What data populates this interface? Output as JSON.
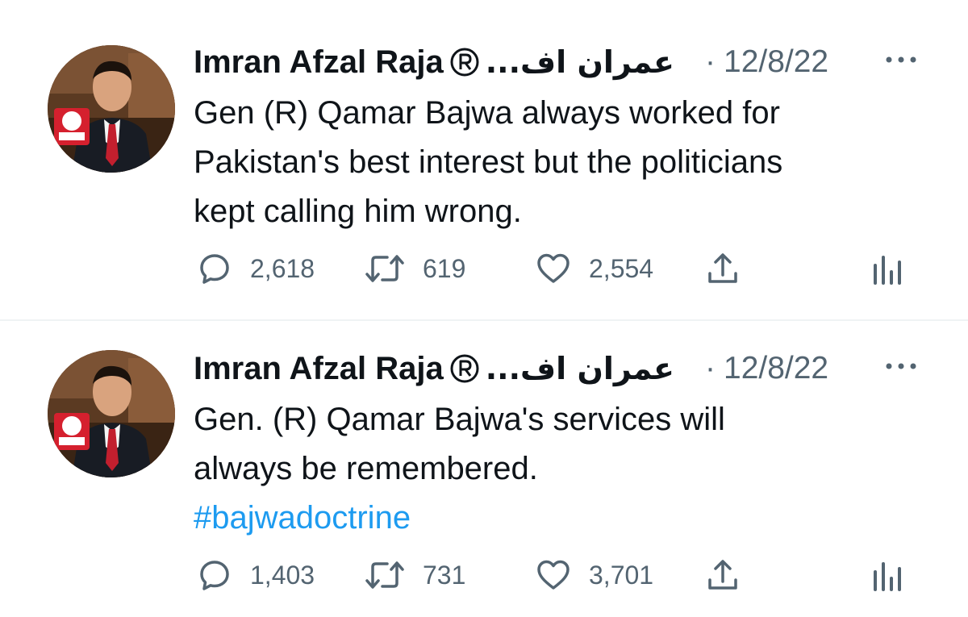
{
  "tweets": [
    {
      "author": {
        "name": "Imran Afzal Raja",
        "badge": "®",
        "urdu_name": "عمران اف...",
        "avatar": "profile-photo"
      },
      "date": "12/8/22",
      "separator": "·",
      "text_lines": [
        "Gen (R) Qamar Bajwa always worked for",
        "Pakistan's best interest but the politicians",
        "kept calling him wrong."
      ],
      "hashtag": "",
      "stats": {
        "replies": "2,618",
        "retweets": "619",
        "likes": "2,554"
      }
    },
    {
      "author": {
        "name": "Imran Afzal Raja",
        "badge": "®",
        "urdu_name": "عمران اف...",
        "avatar": "profile-photo"
      },
      "date": "12/8/22",
      "separator": "·",
      "text_lines": [
        "Gen. (R) Qamar Bajwa's services will",
        "always be remembered."
      ],
      "hashtag": "#bajwadoctrine",
      "stats": {
        "replies": "1,403",
        "retweets": "731",
        "likes": "3,701"
      }
    }
  ],
  "icons": {
    "reply": "reply-icon",
    "retweet": "retweet-icon",
    "like": "heart-icon",
    "share": "share-icon",
    "analytics": "analytics-icon",
    "more": "more-icon"
  },
  "colors": {
    "text": "#0f1419",
    "muted": "#536471",
    "link": "#1d9bf0",
    "divider": "#eff3f4"
  }
}
